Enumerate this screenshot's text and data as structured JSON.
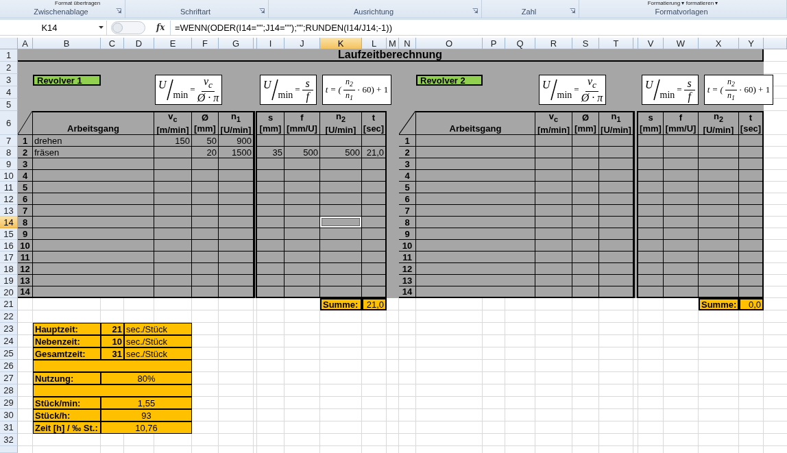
{
  "ribbon": {
    "groups": [
      {
        "label": "Zwischenablage",
        "launcher": true,
        "top_item": "Format übertragen"
      },
      {
        "label": "Schriftart",
        "launcher": true
      },
      {
        "label": "Ausrichtung",
        "launcher": true
      },
      {
        "label": "Zahl",
        "launcher": true
      },
      {
        "label": "Formatvorlagen",
        "launcher": false,
        "top_item": "Formatierung ▾ formatieren ▾"
      }
    ]
  },
  "formula_bar": {
    "name_box": "K14",
    "function_label": "fx",
    "formula": "=WENN(ODER(I14=\"\";J14=\"\");\"\";RUNDEN(I14/J14;-1))"
  },
  "columns": [
    {
      "label": "A",
      "selected": false
    },
    {
      "label": "B",
      "selected": false
    },
    {
      "label": "C",
      "selected": false
    },
    {
      "label": "D",
      "selected": false
    },
    {
      "label": "E",
      "selected": false
    },
    {
      "label": "F",
      "selected": false
    },
    {
      "label": "G",
      "selected": false
    },
    {
      "selected": false
    },
    {
      "label": "I",
      "selected": false
    },
    {
      "label": "J",
      "selected": false
    },
    {
      "label": "K",
      "selected": true
    },
    {
      "label": "L",
      "selected": false
    },
    {
      "label": "M",
      "selected": false
    },
    {
      "label": "N",
      "selected": false
    },
    {
      "label": "O",
      "selected": false
    },
    {
      "label": "P",
      "selected": false
    },
    {
      "label": "Q",
      "selected": false
    },
    {
      "label": "R",
      "selected": false
    },
    {
      "label": "S",
      "selected": false
    },
    {
      "label": "T",
      "selected": false
    },
    {
      "selected": false
    },
    {
      "label": "V",
      "selected": false
    },
    {
      "label": "W",
      "selected": false
    },
    {
      "label": "X",
      "selected": false
    },
    {
      "label": "Y",
      "selected": false
    }
  ],
  "rows": [
    {
      "label": "1",
      "selected": false
    },
    {
      "label": "2",
      "selected": false
    },
    {
      "label": "3",
      "selected": false
    },
    {
      "label": "4",
      "selected": false
    },
    {
      "label": "5",
      "selected": false
    },
    {
      "label": "6",
      "selected": false
    },
    {
      "label": "7",
      "selected": false
    },
    {
      "label": "8",
      "selected": false
    },
    {
      "label": "9",
      "selected": false
    },
    {
      "label": "10",
      "selected": false
    },
    {
      "label": "11",
      "selected": false
    },
    {
      "label": "12",
      "selected": false
    },
    {
      "label": "13",
      "selected": false
    },
    {
      "label": "14",
      "selected": true
    },
    {
      "label": "15",
      "selected": false
    },
    {
      "label": "16",
      "selected": false
    },
    {
      "label": "17",
      "selected": false
    },
    {
      "label": "18",
      "selected": false
    },
    {
      "label": "19",
      "selected": false
    },
    {
      "label": "20",
      "selected": false
    },
    {
      "label": "21",
      "selected": false
    },
    {
      "label": "22",
      "selected": false
    },
    {
      "label": "23",
      "selected": false
    },
    {
      "label": "24",
      "selected": false
    },
    {
      "label": "25",
      "selected": false
    },
    {
      "label": "26",
      "selected": false
    },
    {
      "label": "27",
      "selected": false
    },
    {
      "label": "28",
      "selected": false
    },
    {
      "label": "29",
      "selected": false
    },
    {
      "label": "30",
      "selected": false
    },
    {
      "label": "31",
      "selected": false
    },
    {
      "label": "32",
      "selected": false
    }
  ],
  "title": "Laufzeitberechnung",
  "panels": [
    {
      "label": "Revolver 1",
      "formulas": [
        {
          "kind": "per_unit",
          "unit_top": "U",
          "unit_bottom": "min",
          "equals": "=",
          "top": "v$_{c}$",
          "bottom": "Ø · π"
        },
        {
          "kind": "per_unit",
          "unit_top": "U",
          "unit_bottom": "min",
          "equals": "=",
          "top": "s",
          "bottom": "f"
        },
        {
          "kind": "scaled",
          "lead": "t = (",
          "top": "n$_{2}$",
          "bottom": "n$_{1}$",
          "tail": "· 60) + 1"
        }
      ],
      "operation_header": "Arbeitsgang",
      "columns": [
        {
          "symbol": "v$_{c}$",
          "unit": "[m/min]"
        },
        {
          "symbol": "Ø",
          "unit": "[mm]"
        },
        {
          "symbol": "n$_{1}$",
          "unit": "[U/min]"
        },
        {
          "symbol": "s",
          "unit": "[mm]"
        },
        {
          "symbol": "f",
          "unit": "[mm/U]"
        },
        {
          "symbol": "n$_{2}$",
          "unit": "[U/min]"
        },
        {
          "symbol": "t",
          "unit": "[sec]"
        }
      ],
      "rows": [
        {
          "no": "1",
          "operation": "drehen",
          "values": {
            "0": "150",
            "1": "50",
            "2": "900"
          }
        },
        {
          "no": "2",
          "operation": "fräsen",
          "values": {
            "1": "20",
            "2": "1500",
            "3": "35",
            "4": "500",
            "5": "500",
            "6": "21,0"
          }
        },
        {
          "no": "3"
        },
        {
          "no": "4"
        },
        {
          "no": "5"
        },
        {
          "no": "6"
        },
        {
          "no": "7"
        },
        {
          "no": "8"
        },
        {
          "no": "9"
        },
        {
          "no": "10"
        },
        {
          "no": "11"
        },
        {
          "no": "12"
        },
        {
          "no": "13"
        },
        {
          "no": "14"
        }
      ],
      "sum_label": "Summe:",
      "sum_value": "21,0"
    },
    {
      "label": "Revolver 2",
      "formulas": [
        {
          "kind": "per_unit",
          "unit_top": "U",
          "unit_bottom": "min",
          "equals": "=",
          "top": "v$_{c}$",
          "bottom": "Ø · π"
        },
        {
          "kind": "per_unit",
          "unit_top": "U",
          "unit_bottom": "min",
          "equals": "=",
          "top": "s",
          "bottom": "f"
        },
        {
          "kind": "scaled",
          "lead": "t = (",
          "top": "n$_{2}$",
          "bottom": "n$_{1}$",
          "tail": "· 60) + 1"
        }
      ],
      "operation_header": "Arbeitsgang",
      "columns": [
        {
          "symbol": "v$_{c}$",
          "unit": "[m/min]"
        },
        {
          "symbol": "Ø",
          "unit": "[mm]"
        },
        {
          "symbol": "n$_{1}$",
          "unit": "[U/min]"
        },
        {
          "symbol": "s",
          "unit": "[mm]"
        },
        {
          "symbol": "f",
          "unit": "[mm/U]"
        },
        {
          "symbol": "n$_{2}$",
          "unit": "[U/min]"
        },
        {
          "symbol": "t",
          "unit": "[sec]"
        }
      ],
      "rows": [
        {
          "no": "1"
        },
        {
          "no": "2"
        },
        {
          "no": "3"
        },
        {
          "no": "4"
        },
        {
          "no": "5"
        },
        {
          "no": "6"
        },
        {
          "no": "7"
        },
        {
          "no": "8"
        },
        {
          "no": "9"
        },
        {
          "no": "10"
        },
        {
          "no": "11"
        },
        {
          "no": "12"
        },
        {
          "no": "13"
        },
        {
          "no": "14"
        }
      ],
      "sum_label": "Summe:",
      "sum_value": "0,0"
    }
  ],
  "summary": [
    {
      "kind": "time",
      "label": "Hauptzeit:",
      "value": "21",
      "unit": "sec./Stück"
    },
    {
      "kind": "time",
      "label": "Nebenzeit:",
      "value": "10",
      "unit": "sec./Stück"
    },
    {
      "kind": "time",
      "label": "Gesamtzeit:",
      "value": "31",
      "unit": "sec./Stück"
    },
    {
      "kind": "blank"
    },
    {
      "kind": "result",
      "label": "Nutzung:",
      "value": "80%"
    },
    {
      "kind": "blank"
    },
    {
      "kind": "result",
      "label": "Stück/min:",
      "value": "1,55"
    },
    {
      "kind": "result",
      "label": "Stück/h:",
      "value": "93"
    },
    {
      "kind": "result",
      "label": "Zeit [h] / ‰ St.:",
      "value": "10,76"
    }
  ]
}
